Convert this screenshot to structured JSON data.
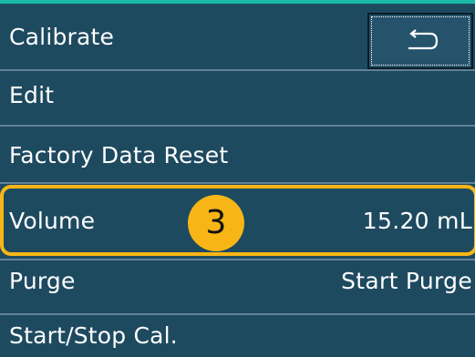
{
  "menu": {
    "title": "Calibrate",
    "back_icon": "return-arrow-icon",
    "items": [
      {
        "label": "Edit"
      },
      {
        "label": "Factory Data Reset"
      },
      {
        "label": "Volume",
        "value": "15.20 mL"
      },
      {
        "label": "Purge",
        "value": "Start Purge"
      },
      {
        "label": "Start/Stop Cal."
      }
    ]
  },
  "annotation": {
    "step_number": "3",
    "highlight_color": "#f7b616"
  },
  "colors": {
    "background": "#1e4a60",
    "divider": "#5f8298",
    "accent": "#19b8a8",
    "text": "#ffffff"
  }
}
